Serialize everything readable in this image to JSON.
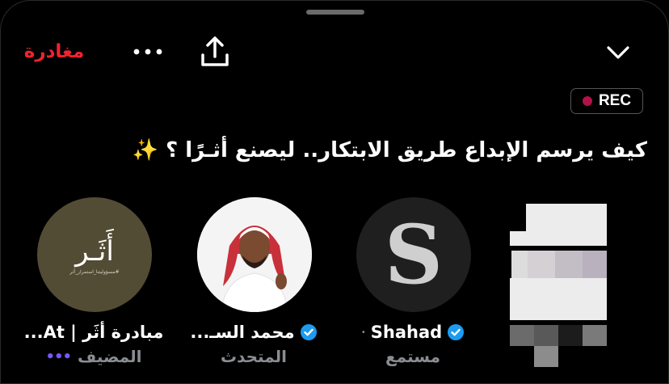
{
  "header": {
    "leave_label": "مغادرة",
    "more_icon": "more-horizontal-icon",
    "share_icon": "share-icon",
    "collapse_icon": "chevron-down-icon"
  },
  "recording_badge": {
    "label": "REC",
    "dot_color": "#b3114a"
  },
  "space_title": "كيف يرسم الإبداع طريق الابتكار.. ليصنع أثـرًا ؟ ✨",
  "speakers": [
    {
      "name": "مبادرة أثَر | At...",
      "role": "المضيف",
      "avatar_text": "أَثَـر",
      "avatar_subtext": "#مسؤوليتنا_استمرار_أثر",
      "talking_indicator": "•••"
    },
    {
      "name": "محمد السـ...",
      "role": "المتحدث",
      "verified": true
    },
    {
      "name": "Shahad",
      "role": "مستمع",
      "verified": true,
      "avatar_letter": "S"
    },
    {
      "name": "",
      "role": ""
    }
  ],
  "colors": {
    "accent_red": "#f4212e",
    "verified_blue": "#1d9bf0",
    "muted": "#8a8d91",
    "host_indicator": "#7856ff"
  }
}
